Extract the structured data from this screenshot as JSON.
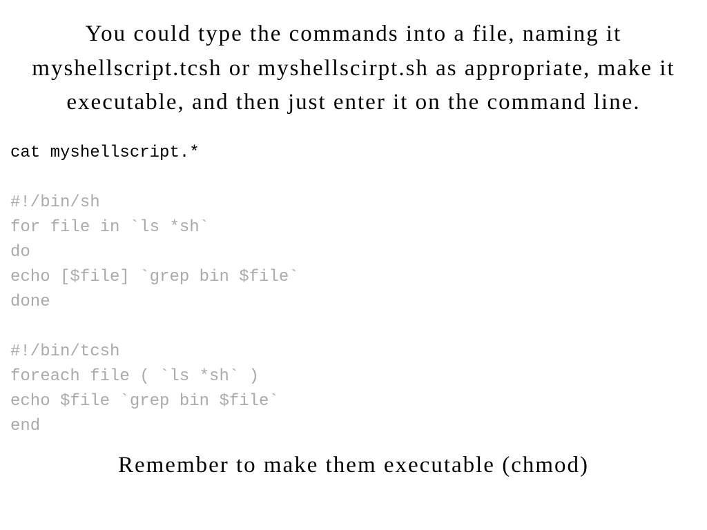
{
  "intro": "You could type the commands into a file, naming it myshellscript.tcsh or myshellscirpt.sh as appropriate, make it executable, and then just enter it on the command line.",
  "code": {
    "cmd": "cat myshellscript.*",
    "sh": [
      "#!/bin/sh",
      "for file in `ls *sh`",
      "do",
      "echo [$file] `grep bin $file`",
      "done"
    ],
    "tcsh": [
      "#!/bin/tcsh",
      "foreach file ( `ls *sh` )",
      "echo $file `grep bin $file`",
      "end"
    ]
  },
  "footer": "Remember to make them executable (chmod)"
}
